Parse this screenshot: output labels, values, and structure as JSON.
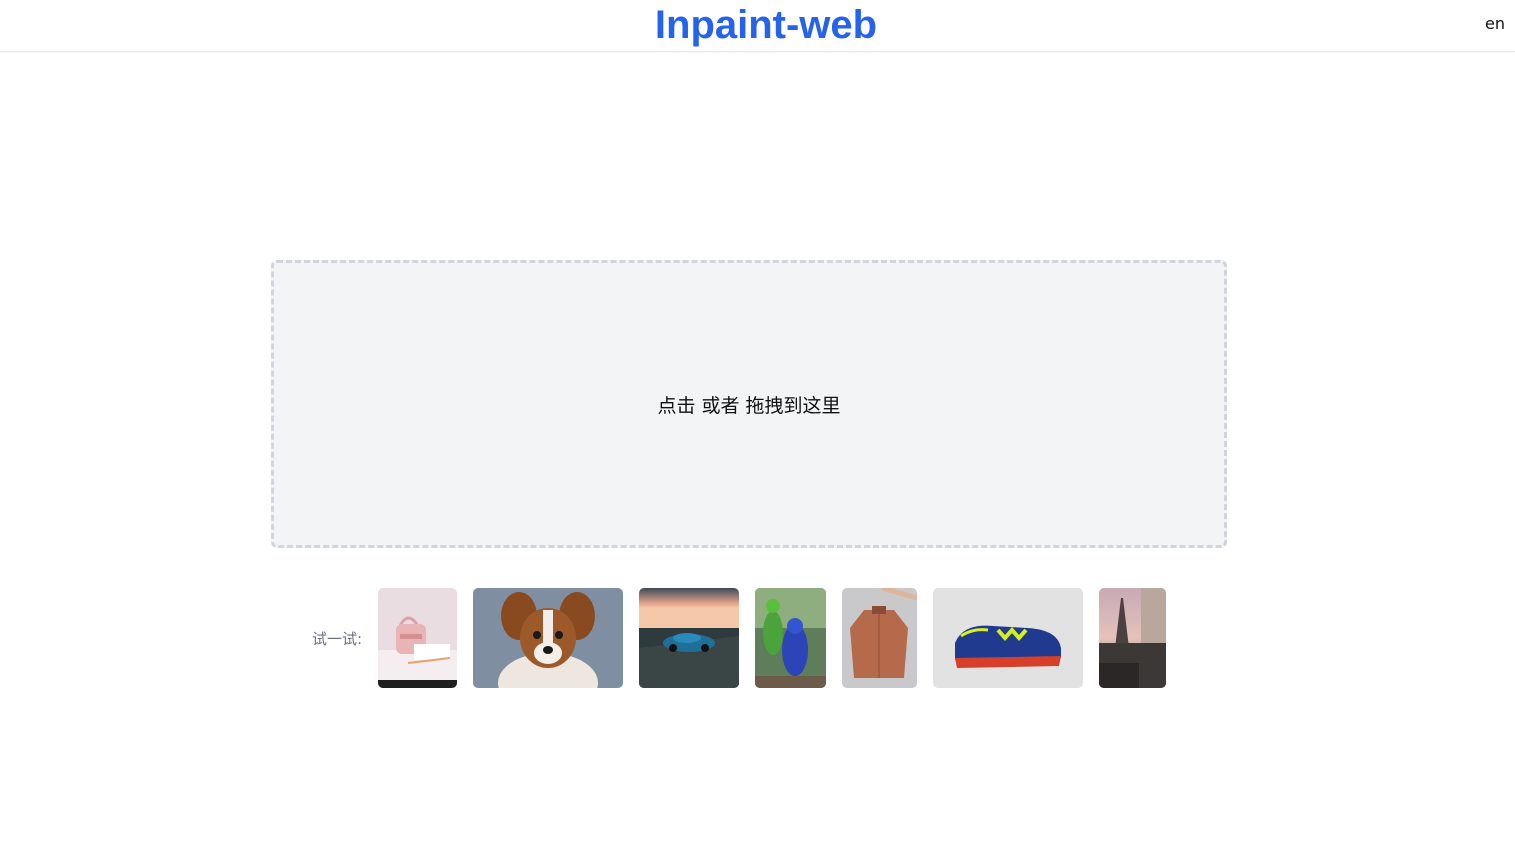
{
  "header": {
    "title": "Inpaint-web",
    "lang": "en",
    "title_color": "#2563eb"
  },
  "dropzone": {
    "text": "点击 或者 拖拽到这里"
  },
  "samples": {
    "label": "试一试:",
    "items": [
      {
        "name": "pink-handbag-image"
      },
      {
        "name": "papillon-dog-image"
      },
      {
        "name": "blue-car-image"
      },
      {
        "name": "parrots-image"
      },
      {
        "name": "brown-jacket-image"
      },
      {
        "name": "blue-sneaker-image"
      },
      {
        "name": "paris-street-image"
      }
    ]
  }
}
